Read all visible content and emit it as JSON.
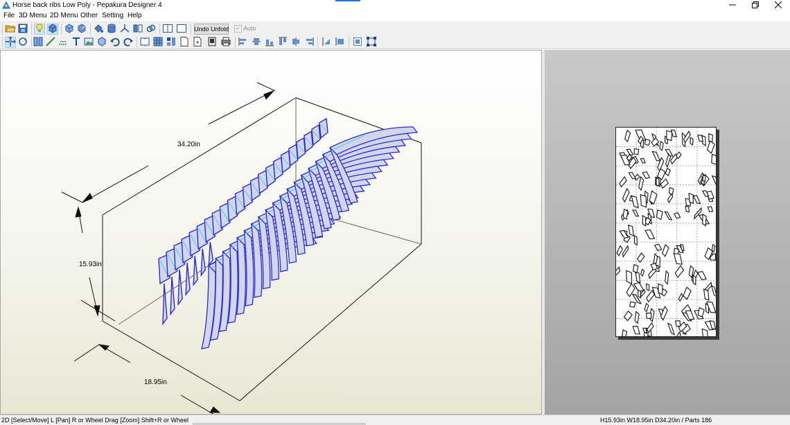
{
  "window": {
    "title": "Horse back ribs Low Poly - Pepakura Designer 4",
    "controls": {
      "minimize": "minimize-icon",
      "maximize": "restore-icon",
      "close": "close-icon"
    }
  },
  "menu": {
    "items": [
      "File",
      "3D Menu",
      "2D Menu",
      "Other",
      "Setting",
      "Help"
    ]
  },
  "toolbar": {
    "undo_unfold_label": "Undo Unfold",
    "auto_label": "Auto",
    "auto_checked": true,
    "auto_enabled": false,
    "row1_icons": [
      "open-icon",
      "save-icon",
      "light-bulb-icon",
      "texture-icon",
      "view-cube-icon",
      "view-cube-rotate-icon",
      "paint-bucket-icon",
      "cylinder-icon",
      "axis-icon",
      "split-view-icon",
      "link-icon",
      "layout-3d-2d-icon",
      "layout-single-icon"
    ],
    "row2_icons": [
      "select-move-icon",
      "rotate-icon",
      "join-icon",
      "line-icon",
      "fold-icon",
      "text-icon",
      "image-icon",
      "cube-icon",
      "undo-icon",
      "redo-icon",
      "book-icon",
      "grid-icon",
      "layout-icon",
      "page-icon",
      "page-add-icon",
      "print-preview-icon",
      "print-icon",
      "align-left-icon",
      "align-center-icon",
      "align-right-icon",
      "align-top-icon",
      "align-middle-icon",
      "align-bottom-icon",
      "distribute-h-icon",
      "distribute-v-icon",
      "select-all-icon",
      "frame-select-icon"
    ]
  },
  "view3d": {
    "dimensions": {
      "depth": "34.20in",
      "height": "15.93in",
      "width": "18.95in"
    },
    "model_color": "#2a2ae0",
    "edge_highlight_color": "#3fd0ee",
    "face_color": "#d2d6ea"
  },
  "view2d": {
    "background_top": "#c8c8c8",
    "background_bottom": "#a4a4a4",
    "paper_grid": {
      "columns": 5,
      "rows": 11
    }
  },
  "status": {
    "left": "2D [Select/Move] L [Pan] R or Wheel Drag [Zoom] Shift+R or Wheel",
    "right": "H15.93in W18.95in D34.20in / Parts 186"
  }
}
